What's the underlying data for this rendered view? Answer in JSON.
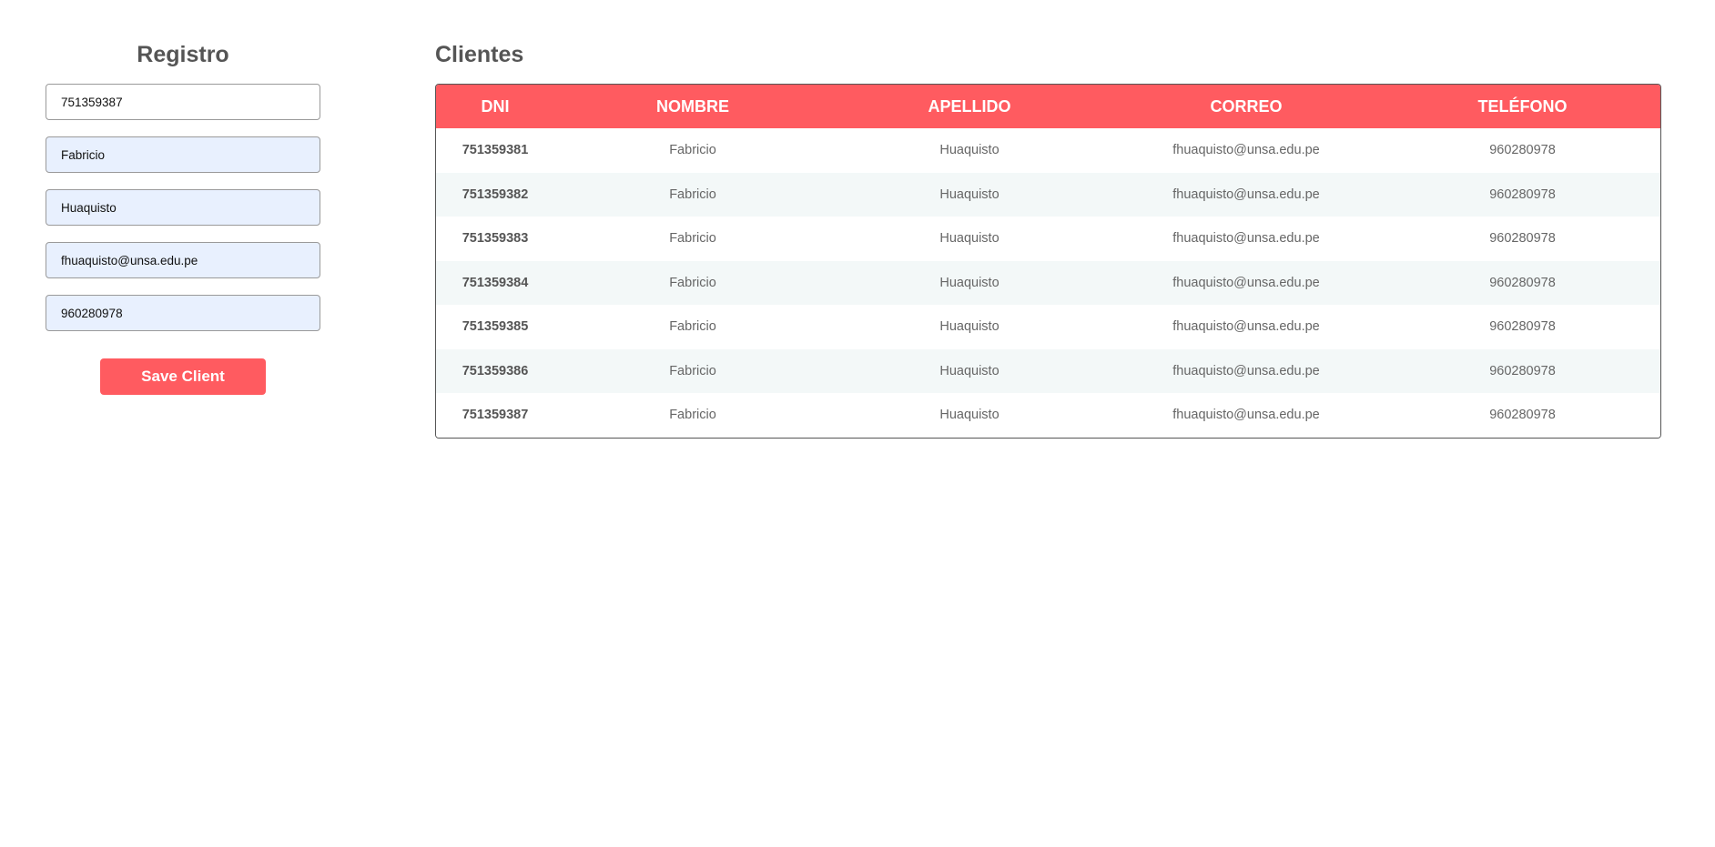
{
  "form": {
    "title": "Registro",
    "fields": [
      {
        "value": "751359387"
      },
      {
        "value": "Fabricio"
      },
      {
        "value": "Huaquisto"
      },
      {
        "value": "fhuaquisto@unsa.edu.pe"
      },
      {
        "value": "960280978"
      }
    ],
    "save_label": "Save Client"
  },
  "table": {
    "title": "Clientes",
    "headers": [
      "DNI",
      "NOMBRE",
      "APELLIDO",
      "CORREO",
      "TELÉFONO"
    ],
    "rows": [
      [
        "751359381",
        "Fabricio",
        "Huaquisto",
        "fhuaquisto@unsa.edu.pe",
        "960280978"
      ],
      [
        "751359382",
        "Fabricio",
        "Huaquisto",
        "fhuaquisto@unsa.edu.pe",
        "960280978"
      ],
      [
        "751359383",
        "Fabricio",
        "Huaquisto",
        "fhuaquisto@unsa.edu.pe",
        "960280978"
      ],
      [
        "751359384",
        "Fabricio",
        "Huaquisto",
        "fhuaquisto@unsa.edu.pe",
        "960280978"
      ],
      [
        "751359385",
        "Fabricio",
        "Huaquisto",
        "fhuaquisto@unsa.edu.pe",
        "960280978"
      ],
      [
        "751359386",
        "Fabricio",
        "Huaquisto",
        "fhuaquisto@unsa.edu.pe",
        "960280978"
      ],
      [
        "751359387",
        "Fabricio",
        "Huaquisto",
        "fhuaquisto@unsa.edu.pe",
        "960280978"
      ]
    ]
  },
  "colors": {
    "accent": "#ff5b60",
    "autofill": "#e8f0fe",
    "stripe": "#f3f8f8",
    "heading": "#555555"
  }
}
